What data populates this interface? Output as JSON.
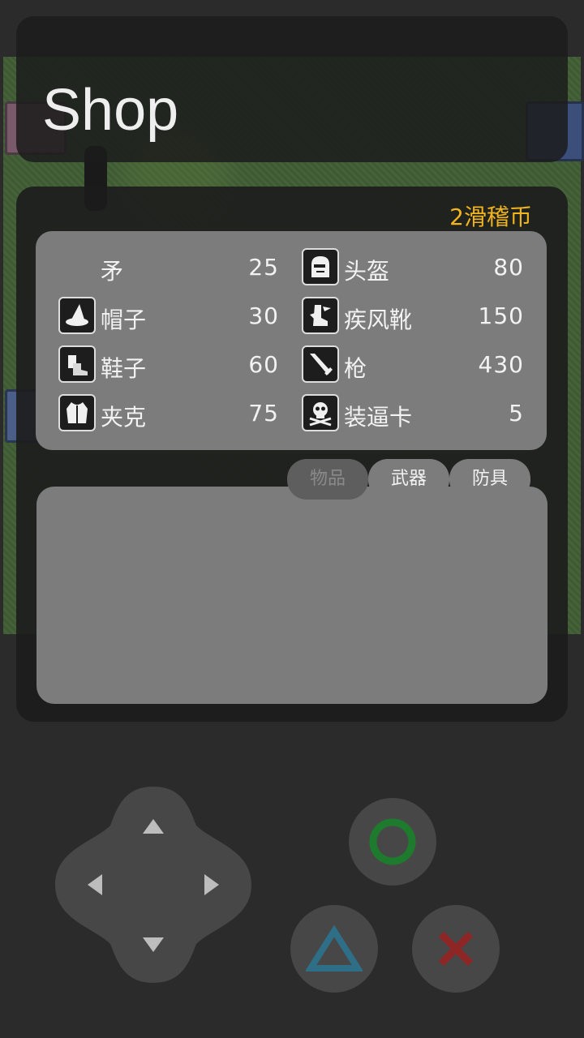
{
  "screen": {
    "title": "Shop"
  },
  "shop": {
    "currency_label": "2滑稽币",
    "items": [
      {
        "name": "矛",
        "price": "25",
        "icon": "none"
      },
      {
        "name": "头盔",
        "price": "80",
        "icon": "helmet-icon"
      },
      {
        "name": "帽子",
        "price": "30",
        "icon": "wizard-hat-icon"
      },
      {
        "name": "疾风靴",
        "price": "150",
        "icon": "winged-boots-icon"
      },
      {
        "name": "鞋子",
        "price": "60",
        "icon": "shoes-icon"
      },
      {
        "name": "枪",
        "price": "430",
        "icon": "sword-icon"
      },
      {
        "name": "夹克",
        "price": "75",
        "icon": "jacket-icon"
      },
      {
        "name": "装逼卡",
        "price": "5",
        "icon": "skull-icon"
      }
    ],
    "tabs": [
      {
        "label": "物品",
        "active": true
      },
      {
        "label": "武器",
        "active": false
      },
      {
        "label": "防具",
        "active": false
      }
    ],
    "description": ""
  },
  "controls": {
    "dpad": [
      "up-arrow-icon",
      "down-arrow-icon",
      "left-arrow-icon",
      "right-arrow-icon"
    ],
    "buttons": [
      {
        "name": "circle",
        "color": "#1e7a2c"
      },
      {
        "name": "triangle",
        "color": "#2e6e86"
      },
      {
        "name": "cross",
        "color": "#8e2626"
      }
    ]
  },
  "colors": {
    "currency": "#f2b51d",
    "panel": "#1c1c1c",
    "list_bg": "#7c7c7c"
  }
}
